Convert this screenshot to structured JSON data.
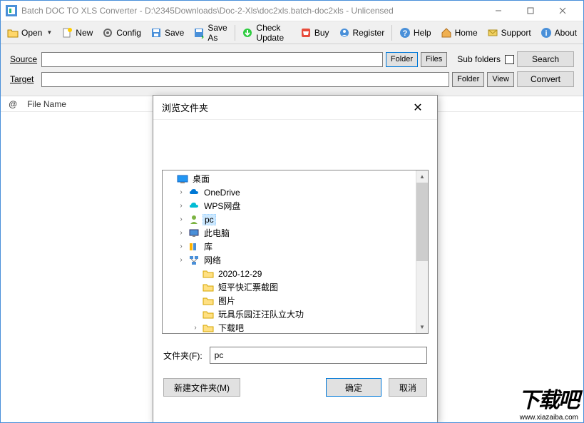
{
  "window": {
    "title": "Batch DOC TO XLS Converter - D:\\2345Downloads\\Doc-2-Xls\\doc2xls.batch-doc2xls - Unlicensed"
  },
  "toolbar": {
    "open": "Open",
    "new": "New",
    "config": "Config",
    "save": "Save",
    "saveas": "Save As",
    "checkupdate": "Check Update",
    "buy": "Buy",
    "register": "Register",
    "help": "Help",
    "home": "Home",
    "support": "Support",
    "about": "About"
  },
  "form": {
    "source_label": "Source",
    "source_value": "",
    "target_label": "Target",
    "target_value": "",
    "folder_btn": "Folder",
    "files_btn": "Files",
    "view_btn": "View",
    "subfolders_label": "Sub folders",
    "search_btn": "Search",
    "convert_btn": "Convert"
  },
  "list": {
    "col_at": "@",
    "col_filename": "File Name"
  },
  "dialog": {
    "title": "浏览文件夹",
    "tree": {
      "root": "桌面",
      "items": [
        {
          "label": "OneDrive",
          "icon": "cloud-blue"
        },
        {
          "label": "WPS网盘",
          "icon": "cloud-cyan"
        },
        {
          "label": "pc",
          "icon": "user",
          "selected": true
        },
        {
          "label": "此电脑",
          "icon": "monitor"
        },
        {
          "label": "库",
          "icon": "libraries"
        },
        {
          "label": "网络",
          "icon": "network"
        }
      ],
      "sub": [
        "2020-12-29",
        "短平快汇票截图",
        "图片",
        "玩具乐园汪汪队立大功",
        "下载吧"
      ]
    },
    "field_label": "文件夹(F):",
    "field_value": "pc",
    "newfolder_btn": "新建文件夹(M)",
    "ok_btn": "确定",
    "cancel_btn": "取消"
  },
  "watermark": {
    "big": "下载吧",
    "small": "www.xiazaiba.com"
  }
}
